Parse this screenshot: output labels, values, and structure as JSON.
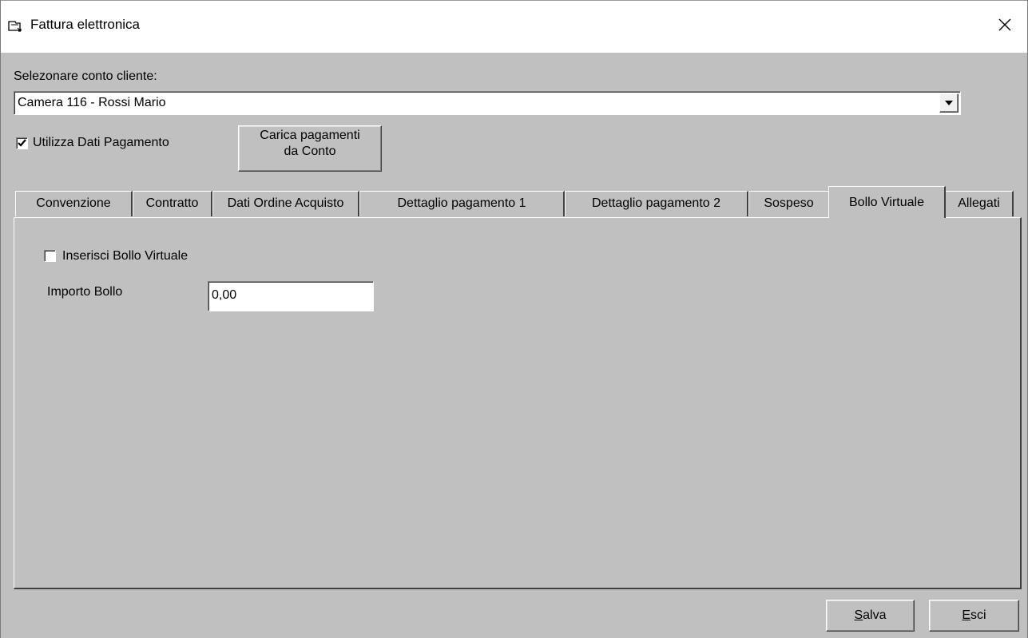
{
  "window": {
    "title": "Fattura elettronica"
  },
  "customer": {
    "label": "Selezonare conto cliente:",
    "selected": "Camera 116 - Rossi Mario"
  },
  "payment": {
    "use_payment_data_label": "Utilizza Dati Pagamento",
    "use_payment_data_checked": true,
    "load_button_line1": "Carica pagamenti",
    "load_button_line2": "da Conto"
  },
  "tabs": [
    {
      "label": "Convenzione"
    },
    {
      "label": "Contratto"
    },
    {
      "label": "Dati Ordine Acquisto"
    },
    {
      "label": "Dettaglio pagamento 1"
    },
    {
      "label": "Dettaglio pagamento 2"
    },
    {
      "label": "Sospeso"
    },
    {
      "label": "Bollo Virtuale",
      "active": true
    },
    {
      "label": "Allegati"
    }
  ],
  "bollo": {
    "insert_label": "Inserisci Bollo Virtuale",
    "insert_checked": false,
    "amount_label": "Importo Bollo",
    "amount_value": "0,00"
  },
  "footer": {
    "save_mnemonic": "S",
    "save_rest": "alva",
    "exit_mnemonic": "E",
    "exit_rest": "sci"
  }
}
